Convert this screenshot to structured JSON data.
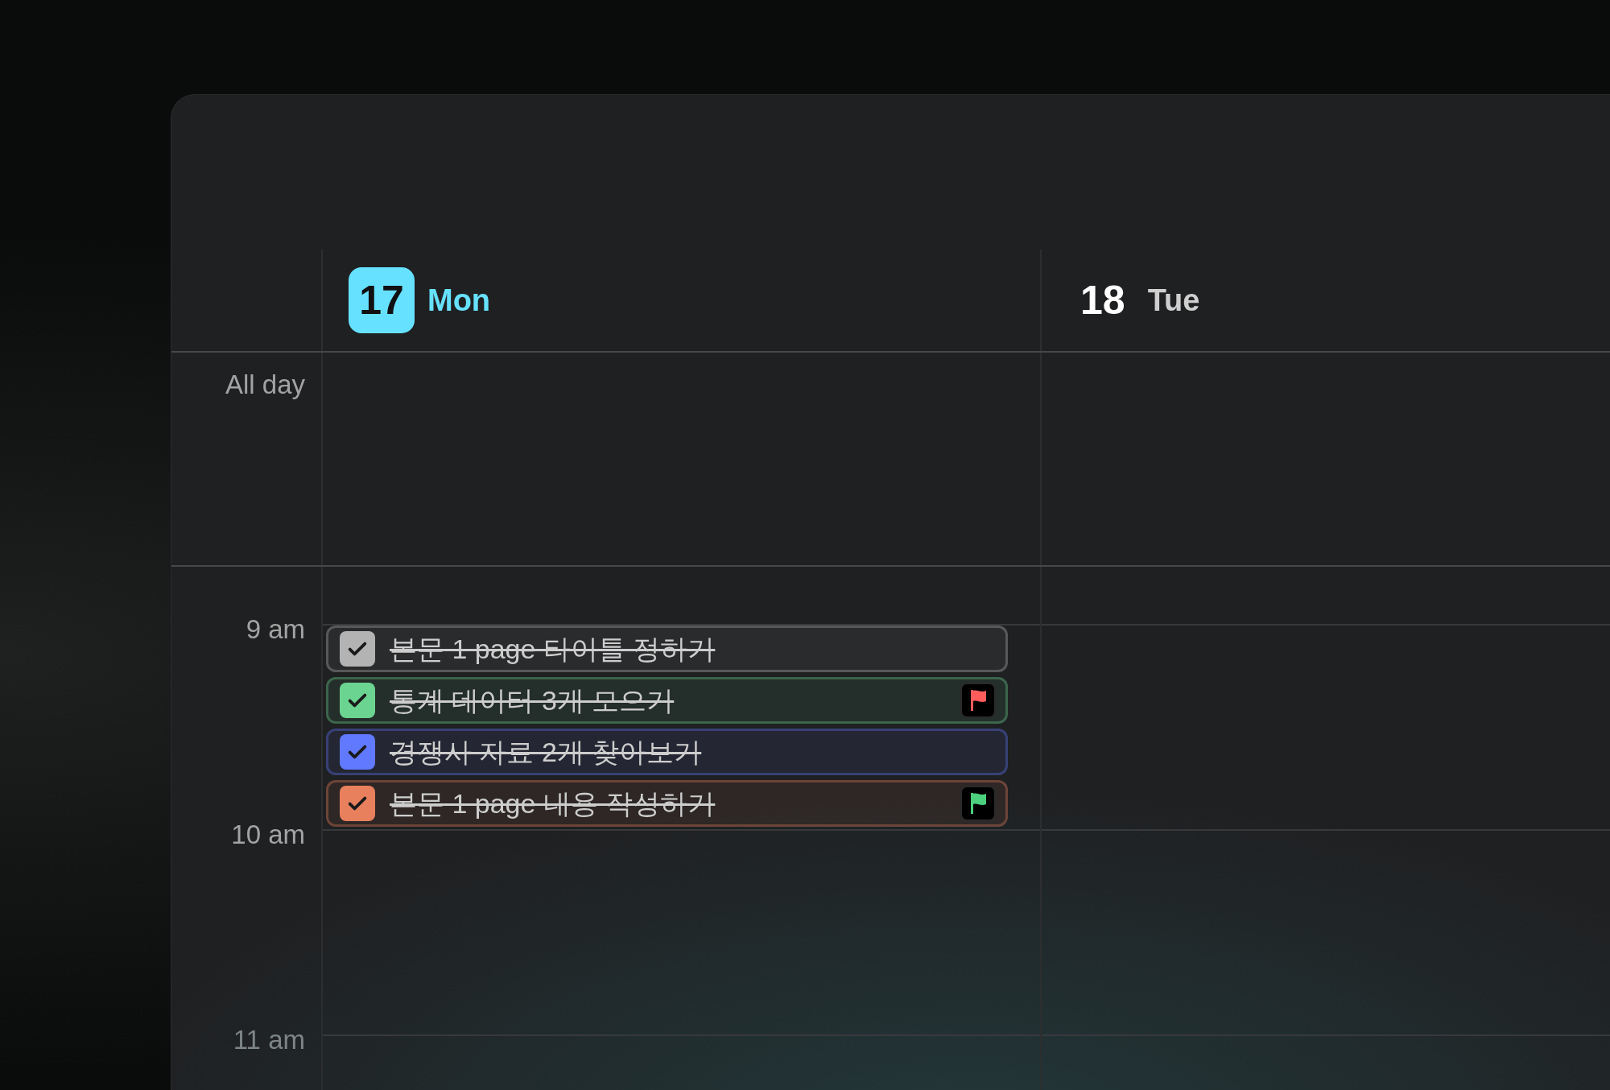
{
  "days": [
    {
      "date": "17",
      "weekday": "Mon",
      "selected": true
    },
    {
      "date": "18",
      "weekday": "Tue",
      "selected": false
    }
  ],
  "all_day_label": "All day",
  "hours": [
    "9 am",
    "10 am",
    "11 am"
  ],
  "tasks": [
    {
      "title": "본문 1 page 타이틀 정하기",
      "color": "#b3b3b3",
      "checked": true
    },
    {
      "title": "통계 데이터 3개 모으기",
      "color": "#6bd490",
      "checked": true,
      "flag": {
        "color": "#ff5c5c"
      }
    },
    {
      "title": "경쟁사 자료 2개 찾아보기",
      "color": "#6079ff",
      "checked": true
    },
    {
      "title": "본문 1 page 내용 작성하기",
      "color": "#e8805e",
      "checked": true,
      "flag": {
        "color": "#4cd07d"
      }
    }
  ]
}
